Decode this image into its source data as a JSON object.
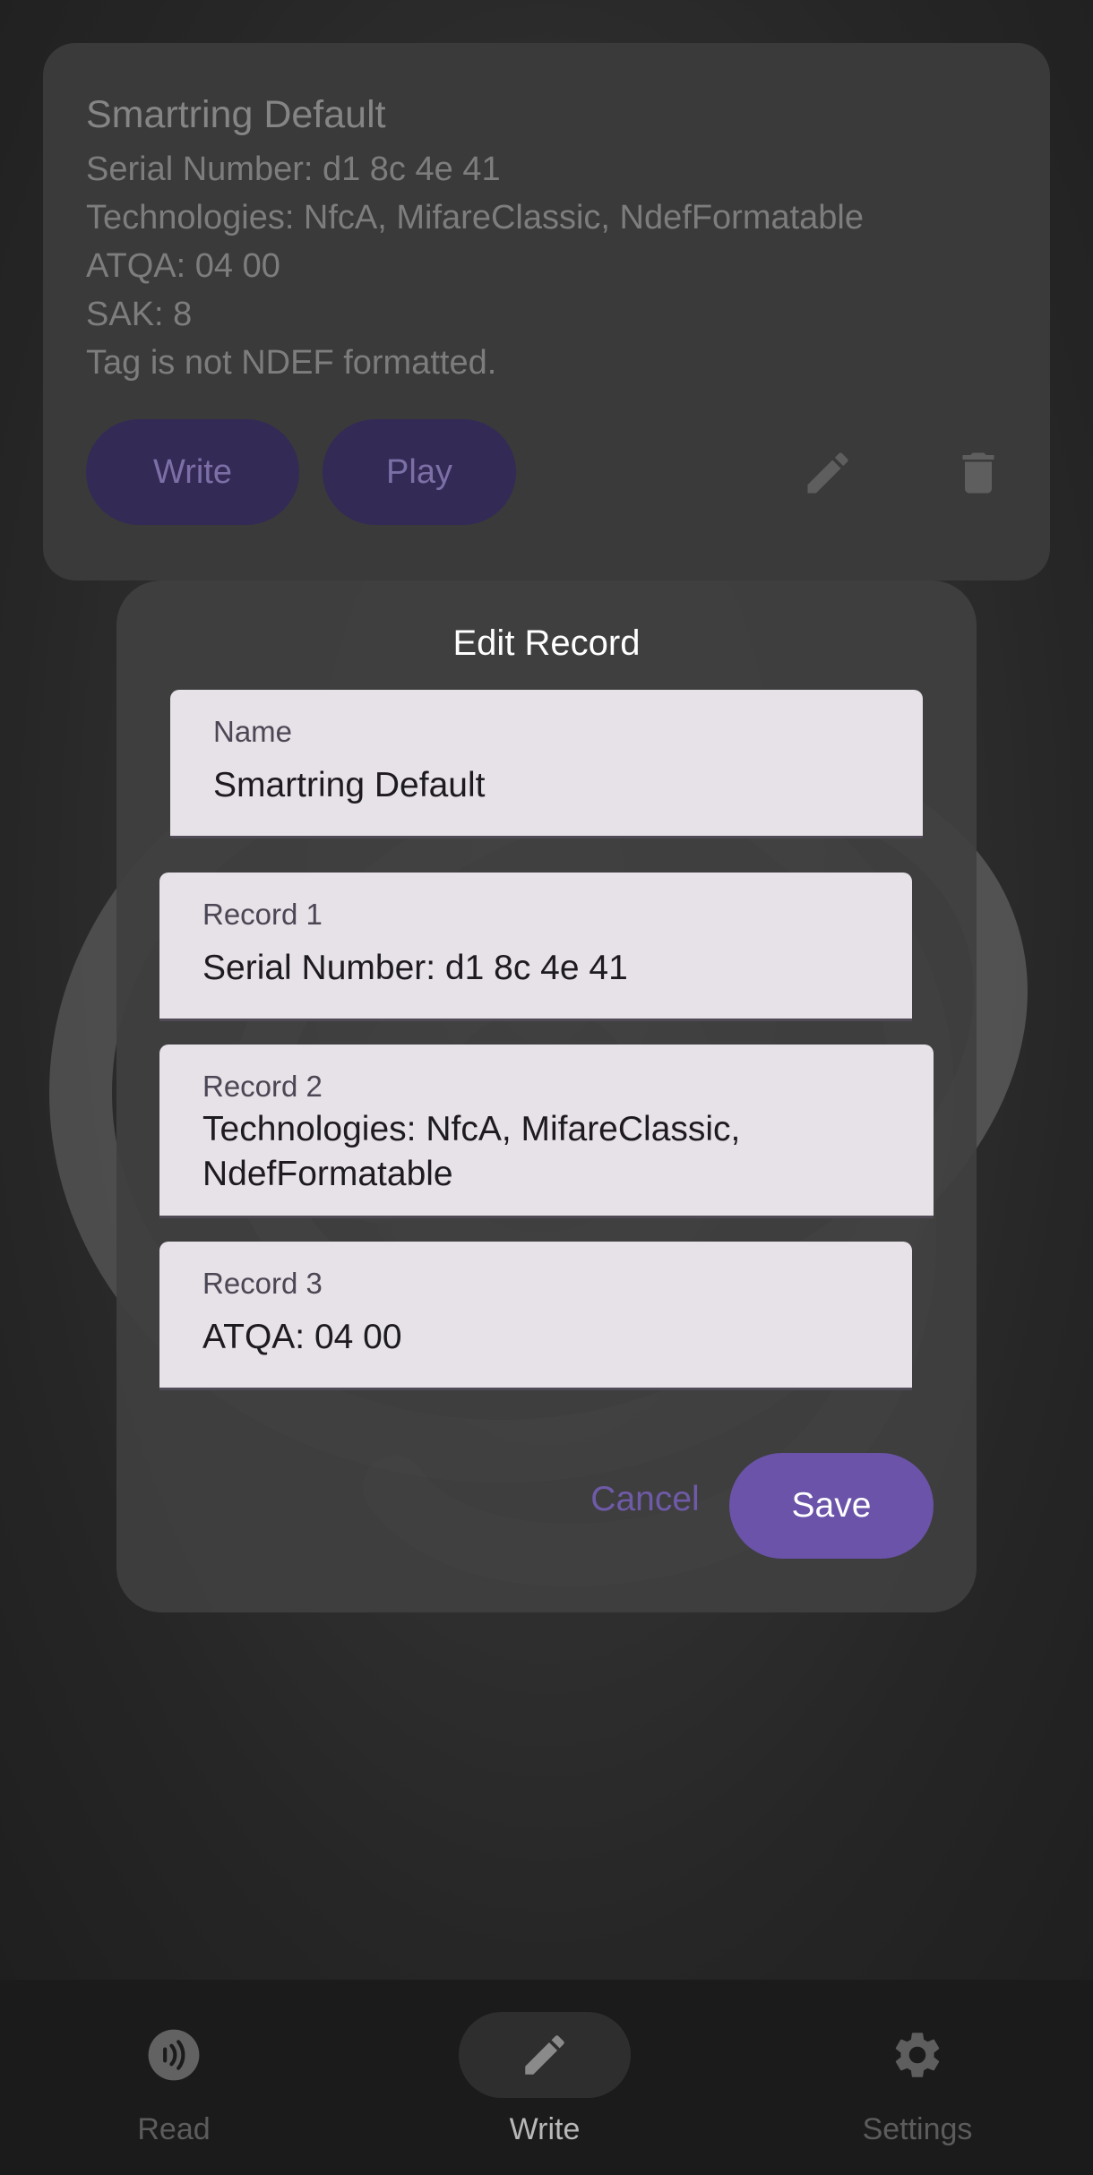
{
  "tag_card": {
    "title": "Smartring Default",
    "lines": [
      "Serial Number: d1 8c 4e 41",
      "Technologies: NfcA, MifareClassic, NdefFormatable",
      "ATQA: 04 00",
      "SAK: 8",
      "Tag is not NDEF formatted."
    ],
    "write_label": "Write",
    "play_label": "Play"
  },
  "dialog": {
    "title": "Edit Record",
    "name_field": {
      "label": "Name",
      "value": "Smartring Default"
    },
    "records": [
      {
        "label": "Record 1",
        "value": "Serial Number: d1 8c 4e 41"
      },
      {
        "label": "Record 2",
        "value": "Technologies: NfcA, MifareClassic, NdefFormatable"
      },
      {
        "label": "Record 3",
        "value": "ATQA: 04 00"
      }
    ],
    "cancel_label": "Cancel",
    "save_label": "Save"
  },
  "nav": {
    "items": [
      {
        "label": "Read",
        "icon": "nfc-icon",
        "selected": false
      },
      {
        "label": "Write",
        "icon": "pencil-icon",
        "selected": true
      },
      {
        "label": "Settings",
        "icon": "gear-icon",
        "selected": false
      }
    ]
  },
  "colors": {
    "accent": "#6a53a8",
    "field_bg": "#e7e1e8",
    "dim_button": "#332a56"
  }
}
